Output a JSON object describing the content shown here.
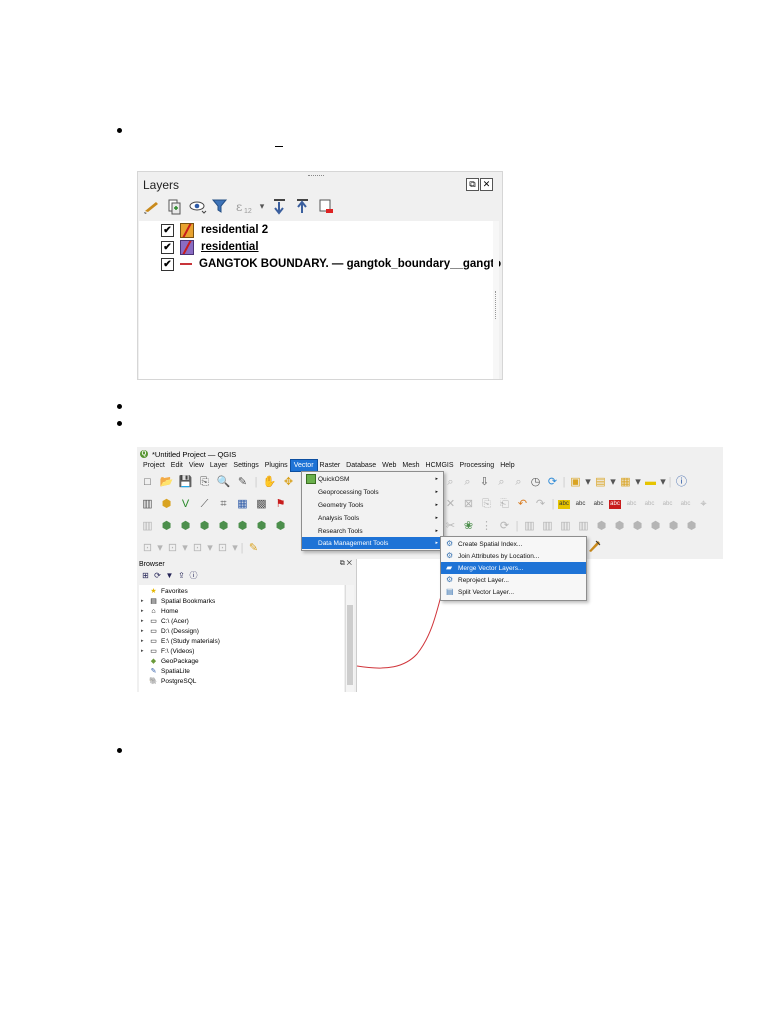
{
  "layers_panel": {
    "title": "Layers",
    "dock_buttons": [
      "⧉",
      "✕"
    ],
    "toolbar_icons": [
      "style-manager-icon",
      "add-group-icon",
      "visibility-icon",
      "filter-icon",
      "filter-expression-icon",
      "expand-all-icon",
      "collapse-all-icon",
      "remove-layer-icon"
    ],
    "layers": [
      {
        "name": "residential 2",
        "checked": true,
        "symbol": "polygon-orange",
        "check_mark": "✔"
      },
      {
        "name": "residential",
        "checked": true,
        "symbol": "polygon-purple",
        "check_mark": "✔",
        "underlined": true
      },
      {
        "name": "GANGTOK BOUNDARY. — gangtok_boundary__gangtok",
        "checked": true,
        "symbol": "line-red",
        "check_mark": "✔"
      }
    ]
  },
  "qgis": {
    "window_title": "*Untitled Project — QGIS",
    "logo_letter": "Q",
    "menu": [
      "Project",
      "Edit",
      "View",
      "Layer",
      "Settings",
      "Plugins",
      "Vector",
      "Raster",
      "Database",
      "Web",
      "Mesh",
      "HCMGIS",
      "Processing",
      "Help"
    ],
    "active_menu": "Vector",
    "vector_menu": [
      {
        "label": "QuickOSM",
        "has_submenu": true
      },
      {
        "label": "Geoprocessing Tools",
        "has_submenu": true
      },
      {
        "label": "Geometry Tools",
        "has_submenu": true
      },
      {
        "label": "Analysis Tools",
        "has_submenu": true
      },
      {
        "label": "Research Tools",
        "has_submenu": true
      },
      {
        "label": "Data Management Tools",
        "has_submenu": true,
        "highlighted": true
      }
    ],
    "submenu_arrow": "▸",
    "submenu": [
      {
        "label": "Create Spatial Index...",
        "icon": "⚙"
      },
      {
        "label": "Join Attributes by Location...",
        "icon": "⚙"
      },
      {
        "label": "Merge Vector Layers...",
        "icon": "▰",
        "highlighted": true
      },
      {
        "label": "Reproject Layer...",
        "icon": "⚙"
      },
      {
        "label": "Split Vector Layer...",
        "icon": "▤"
      }
    ],
    "browser": {
      "title": "Browser",
      "panel_buttons": "⧉ ✕",
      "tools": [
        "⊞",
        "⟳",
        "▼",
        "⇪",
        "ⓘ"
      ],
      "items": [
        {
          "label": "Favorites",
          "icon": "★",
          "arrow": ""
        },
        {
          "label": "Spatial Bookmarks",
          "icon": "▤",
          "arrow": "▸"
        },
        {
          "label": "Home",
          "icon": "⌂",
          "arrow": "▸"
        },
        {
          "label": "C:\\ (Acer)",
          "icon": "▭",
          "arrow": "▸"
        },
        {
          "label": "D:\\ (Dessign)",
          "icon": "▭",
          "arrow": "▸"
        },
        {
          "label": "E:\\ (Study materials)",
          "icon": "▭",
          "arrow": "▸"
        },
        {
          "label": "F:\\ (Videos)",
          "icon": "▭",
          "arrow": "▸"
        },
        {
          "label": "GeoPackage",
          "icon": "◆",
          "arrow": ""
        },
        {
          "label": "SpatiaLite",
          "icon": "✎",
          "arrow": ""
        },
        {
          "label": "PostgreSQL",
          "icon": "🐘",
          "arrow": ""
        }
      ]
    },
    "toolbar_row1": [
      "□",
      "📂",
      "💾",
      "⎘",
      "🔍",
      "✎",
      "|",
      "✋",
      "✥"
    ],
    "toolbar_row1_right": [
      "⌕",
      "⌕",
      "⇩",
      "⌕",
      "⌕",
      "◷",
      "⟳",
      "|",
      "▣",
      "▾",
      "▤",
      "▾",
      "▦",
      "▾",
      "▬",
      "▾",
      "|",
      "ⓘ"
    ],
    "toolbar_row2": [
      "▥",
      "⬢",
      "V",
      "⟋",
      "⌗",
      "▦",
      "▩",
      "⚑"
    ],
    "toolbar_row2_right": [
      "✕",
      "⊠",
      "⎘",
      "⎗",
      "↶",
      "↷",
      "|",
      "abc",
      "abc",
      "abc",
      "abc",
      "abc",
      "abc",
      "abc",
      "abc",
      "⌖"
    ],
    "toolbar_row3": [
      "▥",
      "⬢",
      "⬢",
      "⬢",
      "⬢",
      "⬢",
      "⬢",
      "⬢"
    ],
    "toolbar_row3_right": [
      "✂",
      "❀",
      "⋮",
      "⟳",
      "|",
      "▥",
      "▥",
      "▥",
      "▥",
      "⬢",
      "⬢",
      "⬢",
      "⬢",
      "⬢",
      "⬢"
    ],
    "toolbar_row4": [
      "⊡",
      "▾",
      "⊡",
      "▾",
      "⊡",
      "▾",
      "⊡",
      "▾",
      "|",
      "✎"
    ]
  },
  "colors": {
    "menu_highlight": "#1e73d6",
    "boundary_line": "#d0343a"
  }
}
